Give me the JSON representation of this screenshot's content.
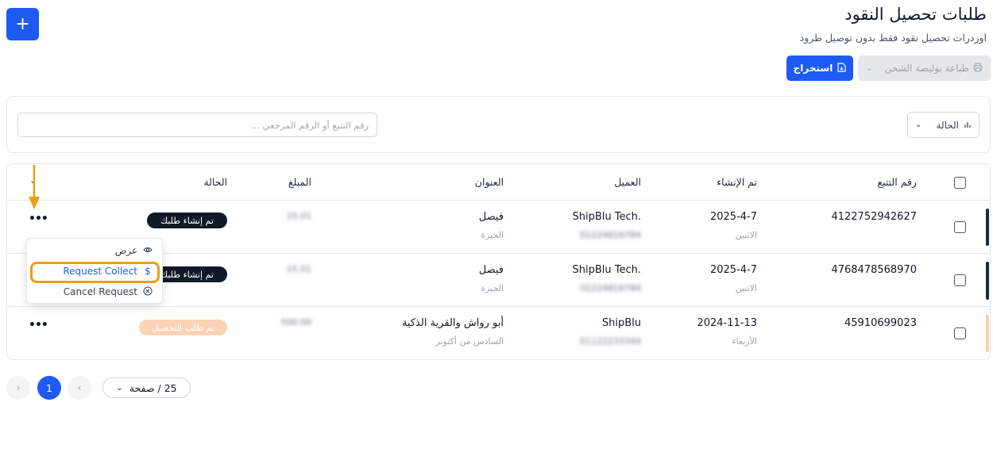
{
  "header": {
    "title": "طلبات تحصيل النقود",
    "subtitle": "اوردرات تحصيل نقود فقط بدون توصيل طرود",
    "add_label": "+"
  },
  "toolbar": {
    "print_label": "طباعة بوليصة الشحن",
    "export_label": "استخراج"
  },
  "filters": {
    "status_label": "الحالة",
    "search_placeholder": "رقم التتبع أو الرقم المرجعي ..."
  },
  "table": {
    "columns": [
      "رقم التتبع",
      "تم الإنشاء",
      "العميل",
      "العنوان",
      "المبلغ",
      "الحالة"
    ],
    "rows": [
      {
        "tracking": "4122752942627",
        "created_date": "2025-4-7",
        "created_day": "الاثنين",
        "customer": "ShipBlu Tech.",
        "customer_phone": "01224816784",
        "address": "فيصل",
        "address_area": "الجيزة",
        "amount": "15.01",
        "status": "تم إنشاء طلبك",
        "status_color": "#111827",
        "edge_color": "#1f2937"
      },
      {
        "tracking": "4768478568970",
        "created_date": "2025-4-7",
        "created_day": "الاثنين",
        "customer": "ShipBlu Tech.",
        "customer_phone": "01224816784",
        "address": "فيصل",
        "address_area": "الجيزة",
        "amount": "15.01",
        "status": "تم إنشاء طلبك",
        "status_color": "#111827",
        "edge_color": "#1f2937"
      },
      {
        "tracking": "45910699023",
        "created_date": "2024-11-13",
        "created_day": "الأربعاء",
        "customer": "ShipBlu",
        "customer_phone": "01122233344",
        "address": "أبو رواش والقرية الذكية",
        "address_area": "السادس من أكتوبر",
        "amount": "500.00",
        "status": "تم طلب التحصيل",
        "status_color": "#fcd3b7",
        "edge_color": "#fbd0b0"
      }
    ]
  },
  "actions_menu": {
    "view_label": "عرض",
    "collect_label": "Request Collect",
    "cancel_label": "Cancel Request"
  },
  "pagination": {
    "current_page": "1",
    "per_page_label": "25 / صفحة"
  },
  "icons": [
    "plus-icon",
    "printer-icon",
    "chevron-down-icon",
    "document-export-icon",
    "filter-bars-icon",
    "more-dots-icon",
    "eye-icon",
    "dollar-icon",
    "cancel-circle-icon",
    "chevron-left-icon",
    "chevron-right-icon",
    "arrow-down-icon"
  ],
  "colors": {
    "primary": "#1e5bf2",
    "highlight": "#f29c0f"
  }
}
